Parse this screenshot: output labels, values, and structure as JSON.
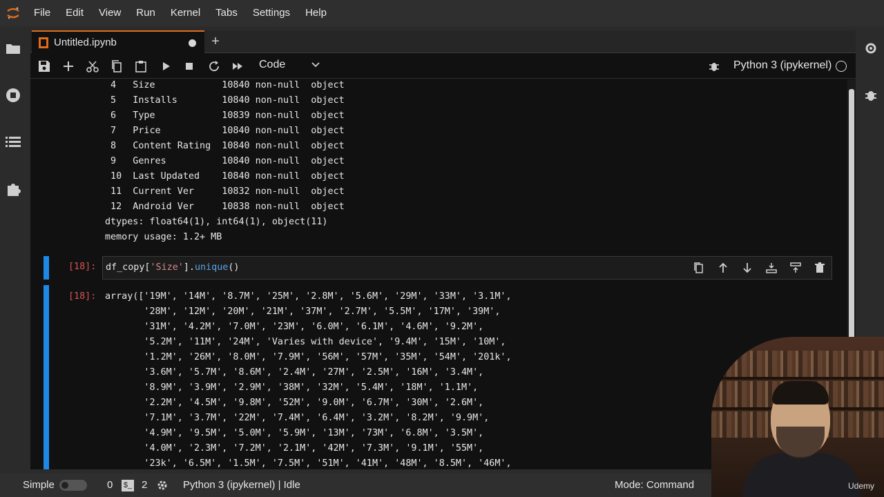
{
  "menubar": {
    "items": [
      "File",
      "Edit",
      "View",
      "Run",
      "Kernel",
      "Tabs",
      "Settings",
      "Help"
    ]
  },
  "tab": {
    "title": "Untitled.ipynb",
    "add_label": "+"
  },
  "toolbar": {
    "cell_type": "Code",
    "kernel": "Python 3 (ipykernel)",
    "icons": [
      "save-icon",
      "add-icon",
      "cut-icon",
      "copy-icon",
      "paste-icon",
      "run-icon",
      "stop-icon",
      "restart-icon",
      "fast-forward-icon"
    ]
  },
  "output_info": {
    "rows": [
      " 4   Size            10840 non-null  object",
      " 5   Installs        10840 non-null  object",
      " 6   Type            10839 non-null  object",
      " 7   Price           10840 non-null  object",
      " 8   Content Rating  10840 non-null  object",
      " 9   Genres          10840 non-null  object",
      " 10  Last Updated    10840 non-null  object",
      " 11  Current Ver     10832 non-null  object",
      " 12  Android Ver     10838 non-null  object"
    ],
    "dtypes": "dtypes: float64(1), int64(1), object(11)",
    "memory": "memory usage: 1.2+ MB"
  },
  "cell18": {
    "in_prompt": "[18]:",
    "code_var": "df_copy[",
    "code_str": "'Size'",
    "code_close": "].",
    "code_fn": "unique",
    "code_end": "()",
    "out_prompt": "[18]:",
    "output_lines": [
      "array(['19M', '14M', '8.7M', '25M', '2.8M', '5.6M', '29M', '33M', '3.1M',",
      "       '28M', '12M', '20M', '21M', '37M', '2.7M', '5.5M', '17M', '39M',",
      "       '31M', '4.2M', '7.0M', '23M', '6.0M', '6.1M', '4.6M', '9.2M',",
      "       '5.2M', '11M', '24M', 'Varies with device', '9.4M', '15M', '10M',",
      "       '1.2M', '26M', '8.0M', '7.9M', '56M', '57M', '35M', '54M', '201k',",
      "       '3.6M', '5.7M', '8.6M', '2.4M', '27M', '2.5M', '16M', '3.4M',",
      "       '8.9M', '3.9M', '2.9M', '38M', '32M', '5.4M', '18M', '1.1M',",
      "       '2.2M', '4.5M', '9.8M', '52M', '9.0M', '6.7M', '30M', '2.6M',",
      "       '7.1M', '3.7M', '22M', '7.4M', '6.4M', '3.2M', '8.2M', '9.9M',",
      "       '4.9M', '9.5M', '5.0M', '5.9M', '13M', '73M', '6.8M', '3.5M',",
      "       '4.0M', '2.3M', '7.2M', '2.1M', '42M', '7.3M', '9.1M', '55M',",
      "       '23k', '6.5M', '1.5M', '7.5M', '51M', '41M', '48M', '8.5M', '46M',"
    ]
  },
  "statusbar": {
    "mode_label": "Simple",
    "count_a": "0",
    "count_b": "2",
    "kernel_status": "Python 3 (ipykernel) | Idle",
    "mode": "Mode: Command"
  },
  "watermark": "Udemy",
  "colors": {
    "accent_orange": "#e06c1b",
    "active_cell_bar": "#1e88e5",
    "prompt_red": "#d9534f"
  }
}
